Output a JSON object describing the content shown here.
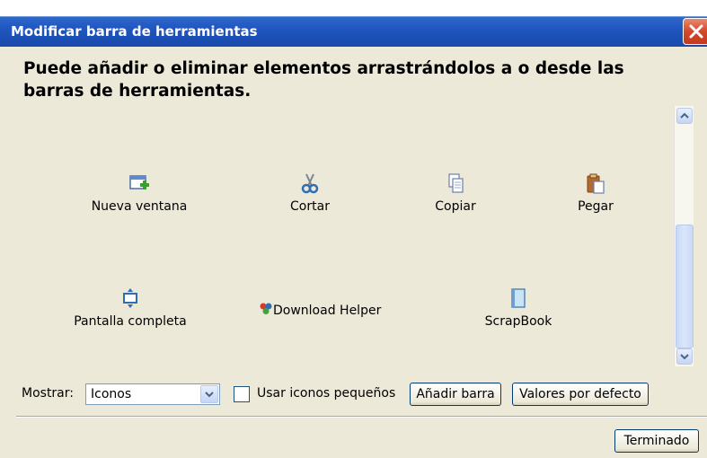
{
  "window": {
    "title": "Modificar barra de herramientas"
  },
  "instruction": "Puede añadir o eliminar elementos arrastrándolos a o desde las barras de herramientas.",
  "palette_items": [
    {
      "label": "Nueva ventana",
      "icon": "new-window-icon"
    },
    {
      "label": "Cortar",
      "icon": "scissors-icon"
    },
    {
      "label": "Copiar",
      "icon": "copy-icon"
    },
    {
      "label": "Pegar",
      "icon": "paste-icon"
    },
    {
      "label": "Pantalla completa",
      "icon": "fullscreen-icon"
    },
    {
      "label": "Download Helper",
      "icon": "download-helper-icon"
    },
    {
      "label": "ScrapBook",
      "icon": "scrapbook-icon"
    }
  ],
  "bottom": {
    "show_label": "Mostrar:",
    "show_value": "Iconos",
    "small_icons_label": "Usar iconos pequeños",
    "small_icons_checked": false,
    "add_bar_label": "Añadir barra",
    "defaults_label": "Valores por defecto",
    "done_label": "Terminado"
  },
  "colors": {
    "titlebar": "#2459c4",
    "close": "#d4482a",
    "dialog_bg": "#ece9d8"
  }
}
